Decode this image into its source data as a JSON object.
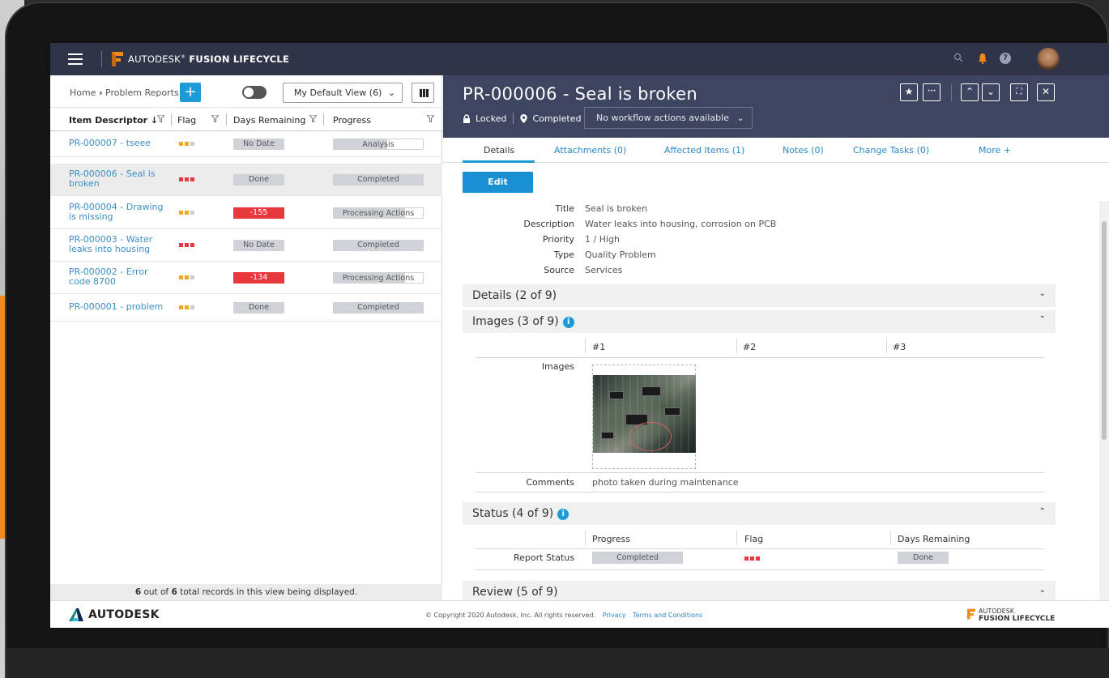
{
  "app": {
    "brand_prefix": "AUTODESK",
    "brand_reg": "®",
    "brand_suffix": " FUSION LIFECYCLE"
  },
  "breadcrumb": {
    "home": "Home",
    "separator": "›",
    "current": "Problem Reports"
  },
  "toolbar": {
    "add_label": "+",
    "view_label": "My Default View (6)",
    "view_chevron": "⌄"
  },
  "columns": {
    "item_descriptor": "Item Descriptor",
    "sort_arrow": "↓",
    "flag": "Flag",
    "days_remaining": "Days Remaining",
    "progress": "Progress"
  },
  "rows": [
    {
      "id_line1": "PR-000007 - tseee",
      "id_line2": "",
      "flag": [
        "#f5a623",
        "#f5a623",
        "#cccccc"
      ],
      "days": "No Date",
      "days_red": false,
      "progress": "Analysis",
      "progress_fill": 0.6
    },
    {
      "id_line1": "PR-000006 - Seal is",
      "id_line2": "broken",
      "flag": [
        "#e8383d",
        "#e8383d",
        "#e8383d"
      ],
      "days": "Done",
      "days_red": false,
      "progress": "Completed",
      "progress_fill": 1.0
    },
    {
      "id_line1": "PR-000004 - Drawing",
      "id_line2": "is missing",
      "flag": [
        "#f5a623",
        "#f5a623",
        "#cccccc"
      ],
      "days": "-155",
      "days_red": true,
      "progress": "Processing Actions",
      "progress_fill": 0.8
    },
    {
      "id_line1": "PR-000003 - Water",
      "id_line2": "leaks into housing",
      "flag": [
        "#e8383d",
        "#e8383d",
        "#e8383d"
      ],
      "days": "No Date",
      "days_red": false,
      "progress": "Completed",
      "progress_fill": 1.0
    },
    {
      "id_line1": "PR-000002 - Error",
      "id_line2": "code 8700",
      "flag": [
        "#f5a623",
        "#f5a623",
        "#cccccc"
      ],
      "days": "-134",
      "days_red": true,
      "progress": "Processing Actions",
      "progress_fill": 0.8
    },
    {
      "id_line1": "PR-000001 - problem",
      "id_line2": "",
      "flag": [
        "#f5a623",
        "#f5a623",
        "#cccccc"
      ],
      "days": "Done",
      "days_red": false,
      "progress": "Completed",
      "progress_fill": 1.0
    }
  ],
  "list_footer": {
    "count_shown": "6",
    "text_mid": " out of ",
    "count_total": "6",
    "text_end": " total records in this view being displayed."
  },
  "record": {
    "title": "PR-000006 - Seal is broken",
    "lock_label": "Locked",
    "status_label": "Completed",
    "workflow_label": "No workflow actions available",
    "workflow_chevron": "⌄",
    "buttons": {
      "star": "★",
      "more": "···",
      "up": "⌃",
      "down": "⌄",
      "expand": "⛶",
      "close": "✕"
    }
  },
  "tabs": [
    "Details",
    "Attachments (0)",
    "Affected Items (1)",
    "Notes (0)",
    "Change Tasks (0)",
    "More +"
  ],
  "edit_label": "Edit",
  "fields": [
    {
      "label": "Title",
      "value": "Seal is broken"
    },
    {
      "label": "Description",
      "value": "Water leaks into housing, corrosion on PCB"
    },
    {
      "label": "Priority",
      "value": "1 / High"
    },
    {
      "label": "Type",
      "value": "Quality Problem"
    },
    {
      "label": "Source",
      "value": "Services"
    }
  ],
  "sections": {
    "details": "Details (2 of 9)",
    "images": "Images (3 of 9)",
    "status": "Status (4 of 9)",
    "review": "Review (5 of 9)",
    "chev_down": "⌄",
    "chev_up": "⌃",
    "info": "i"
  },
  "images_grid": {
    "headers": [
      "#1",
      "#2",
      "#3"
    ],
    "row_label": "Images",
    "comments_label": "Comments",
    "comments_value": "photo taken during maintenance"
  },
  "status_grid": {
    "headers": [
      "Progress",
      "Flag",
      "Days Remaining"
    ],
    "row_label": "Report Status",
    "progress_value": "Completed",
    "flag_colors": [
      "#e8383d",
      "#e8383d",
      "#e8383d"
    ],
    "days_value": "Done"
  },
  "footer": {
    "autodesk": "AUTODESK",
    "copyright": "© Copyright 2020 Autodesk, Inc. All rights reserved.",
    "privacy": "Privacy",
    "terms": "Terms and Conditions",
    "fl_line1": "AUTODESK",
    "fl_line2": "FUSION LIFECYCLE"
  },
  "colors": {
    "accent": "#1e9bd7",
    "topbar": "#2f3448",
    "record_header": "#3d4560",
    "orange": "#f08a1c",
    "red": "#e8383d"
  }
}
